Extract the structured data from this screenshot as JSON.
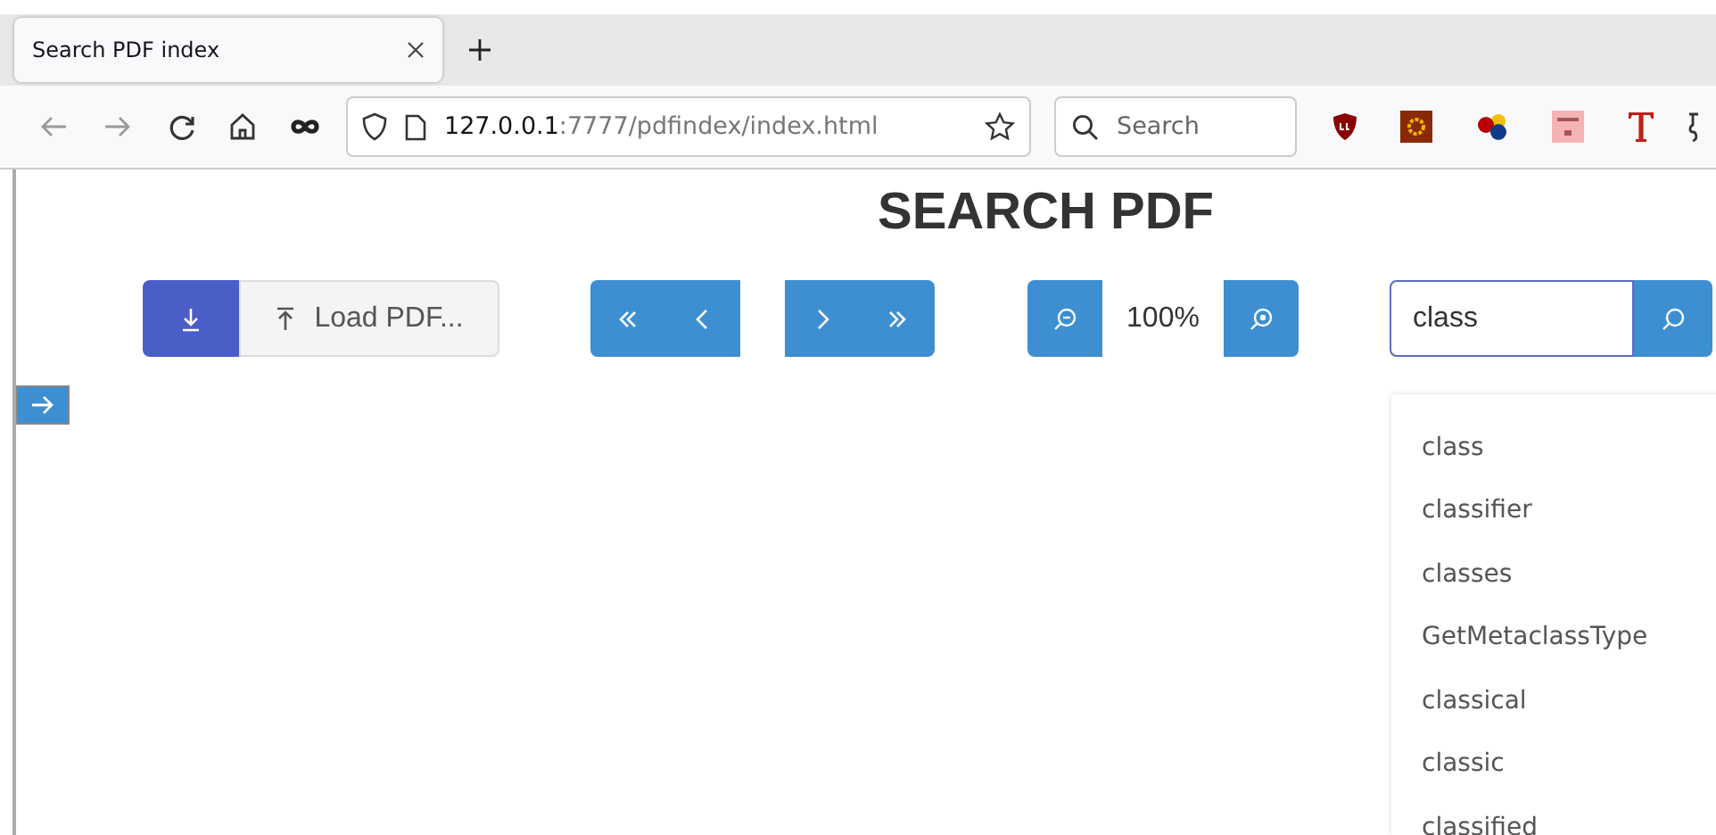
{
  "browser": {
    "tab": {
      "title": "Search PDF index",
      "selected": true
    },
    "url_host": "127.0.0.1",
    "url_path": ":7777/pdfindex/index.html",
    "search_placeholder": "Search"
  },
  "page": {
    "title": "SEARCH PDF",
    "load_button": "Load PDF...",
    "zoom": "100%",
    "search_value": "class",
    "suggestions": [
      "class",
      "classifier",
      "classes",
      "GetMetaclassType",
      "classical",
      "classic",
      "classified"
    ]
  }
}
